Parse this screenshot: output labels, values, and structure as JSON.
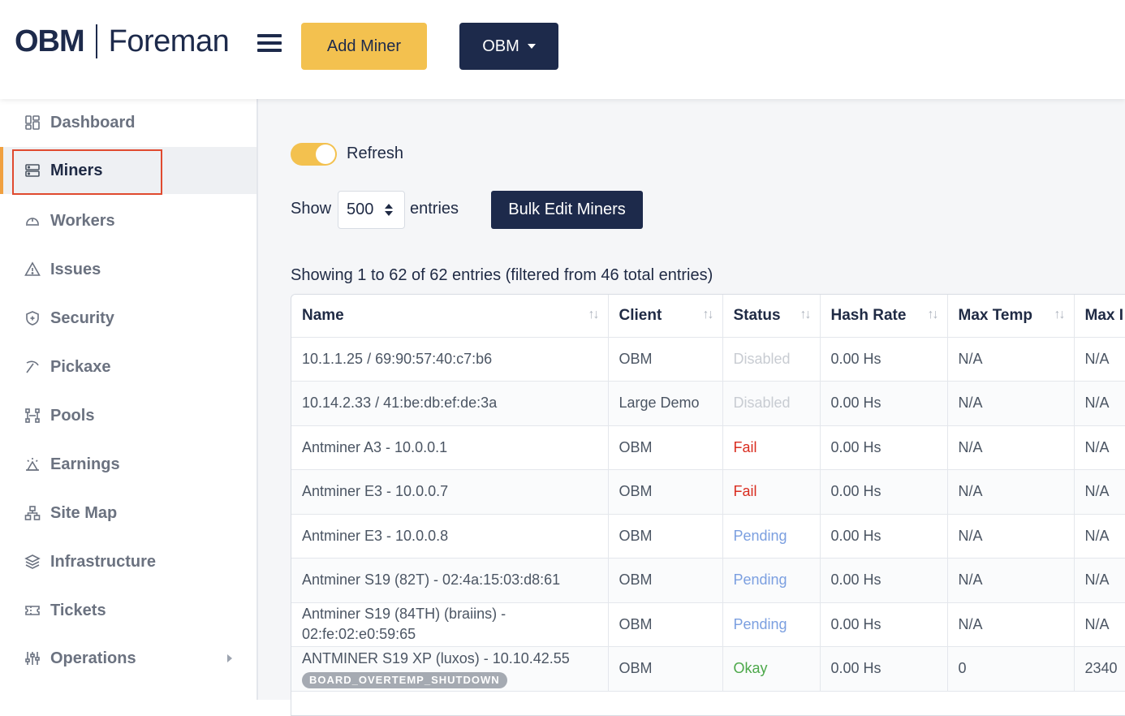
{
  "header": {
    "logo_obm": "OBM",
    "logo_product": "Foreman",
    "add_miner_label": "Add Miner",
    "org_label": "OBM"
  },
  "sidebar": {
    "items": [
      {
        "label": "Dashboard",
        "icon": "dashboard-icon"
      },
      {
        "label": "Miners",
        "icon": "server-icon",
        "active": true
      },
      {
        "label": "Workers",
        "icon": "hardhat-icon"
      },
      {
        "label": "Issues",
        "icon": "warning-icon"
      },
      {
        "label": "Security",
        "icon": "shield-icon"
      },
      {
        "label": "Pickaxe",
        "icon": "pickaxe-icon"
      },
      {
        "label": "Pools",
        "icon": "pools-icon"
      },
      {
        "label": "Earnings",
        "icon": "earnings-icon"
      },
      {
        "label": "Site Map",
        "icon": "sitemap-icon"
      },
      {
        "label": "Infrastructure",
        "icon": "layers-icon"
      },
      {
        "label": "Tickets",
        "icon": "ticket-icon"
      },
      {
        "label": "Operations",
        "icon": "sliders-icon",
        "expandable": true
      }
    ]
  },
  "main": {
    "refresh_label": "Refresh",
    "refresh_on": true,
    "show_label": "Show",
    "show_value": "500",
    "entries_label": "entries",
    "bulk_edit_label": "Bulk Edit Miners",
    "info_text": "Showing 1 to 62 of 62 entries (filtered from 46 total entries)"
  },
  "table": {
    "columns": [
      "Name",
      "Client",
      "Status",
      "Hash Rate",
      "Max Temp",
      "Max I"
    ],
    "rows": [
      {
        "name": "10.1.1.25 / 69:90:57:40:c7:b6",
        "client": "OBM",
        "status": "Disabled",
        "status_type": "disabled",
        "hash_rate": "0.00 Hs",
        "max_temp": "N/A",
        "max_other": "N/A"
      },
      {
        "name": "10.14.2.33 / 41:be:db:ef:de:3a",
        "client": "Large Demo",
        "status": "Disabled",
        "status_type": "disabled",
        "hash_rate": "0.00 Hs",
        "max_temp": "N/A",
        "max_other": "N/A"
      },
      {
        "name": "Antminer A3 - 10.0.0.1",
        "client": "OBM",
        "status": "Fail",
        "status_type": "fail",
        "hash_rate": "0.00 Hs",
        "max_temp": "N/A",
        "max_other": "N/A"
      },
      {
        "name": "Antminer E3 - 10.0.0.7",
        "client": "OBM",
        "status": "Fail",
        "status_type": "fail",
        "hash_rate": "0.00 Hs",
        "max_temp": "N/A",
        "max_other": "N/A"
      },
      {
        "name": "Antminer E3 - 10.0.0.8",
        "client": "OBM",
        "status": "Pending",
        "status_type": "pending",
        "hash_rate": "0.00 Hs",
        "max_temp": "N/A",
        "max_other": "N/A"
      },
      {
        "name": "Antminer S19 (82T) - 02:4a:15:03:d8:61",
        "client": "OBM",
        "status": "Pending",
        "status_type": "pending",
        "hash_rate": "0.00 Hs",
        "max_temp": "N/A",
        "max_other": "N/A"
      },
      {
        "name": "Antminer S19 (84TH) (braiins) - 02:fe:02:e0:59:65",
        "client": "OBM",
        "status": "Pending",
        "status_type": "pending",
        "hash_rate": "0.00 Hs",
        "max_temp": "N/A",
        "max_other": "N/A"
      },
      {
        "name": "ANTMINER S19 XP (luxos) - 10.10.42.55",
        "badge": "BOARD_OVERTEMP_SHUTDOWN",
        "client": "OBM",
        "status": "Okay",
        "status_type": "okay",
        "hash_rate": "0.00 Hs",
        "max_temp": "0",
        "max_other": "2340"
      }
    ]
  },
  "colors": {
    "brand_navy": "#1d2a4b",
    "accent_yellow": "#f3c14f",
    "active_bar": "#f0a040",
    "highlight_outline": "#e04a2f",
    "status_fail": "#d92d20",
    "status_pending": "#7b9fe0",
    "status_okay": "#4ca84a",
    "status_disabled": "#c8ccd2"
  }
}
